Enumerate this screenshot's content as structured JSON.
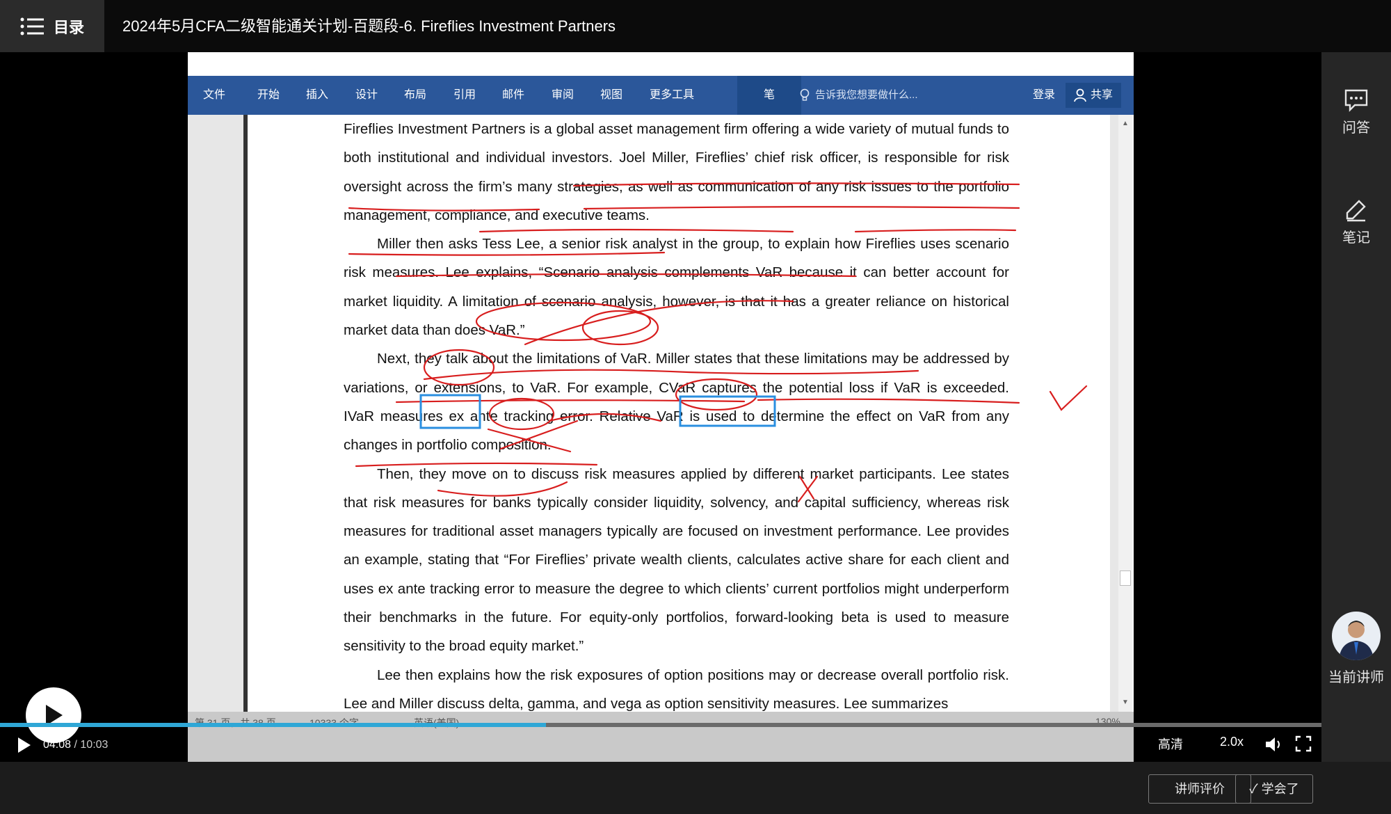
{
  "app": {
    "menu_label": "目录",
    "course_title": "2024年5月CFA二级智能通关计划-百题段-6. Fireflies Investment Partners"
  },
  "ribbon": {
    "tabs": [
      "文件",
      "开始",
      "插入",
      "设计",
      "布局",
      "引用",
      "邮件",
      "审阅",
      "视图",
      "更多工具",
      "笔"
    ],
    "tell_me": "告诉我您想要做什么...",
    "login": "登录",
    "share": "共享"
  },
  "document": {
    "paragraphs": [
      "Fireflies Investment Partners is a global asset management firm offering a wide variety of mutual funds to both institutional and individual investors. Joel Miller, Fireflies’ chief risk officer, is responsible for risk oversight across the firm’s many strategies, as well as communication of any risk issues to the portfolio management, compliance, and executive teams.",
      "Miller then asks Tess Lee, a senior risk analyst in the group, to explain how Fireflies uses scenario risk measures. Lee explains, “Scenario analysis complements VaR because it can better account for market liquidity. A limitation of scenario analysis, however, is that it has a greater reliance on historical market data than does VaR.”",
      "Next, they talk about the limitations of VaR. Miller states that these limitations may be addressed by variations, or extensions, to VaR. For example, CVaR captures the potential loss if VaR is exceeded. IVaR measures ex ante tracking error. Relative VaR is used to determine the effect on VaR from any changes in portfolio composition.",
      "Then, they move on to discuss risk measures applied by different market participants. Lee states that risk measures for banks typically consider liquidity, solvency, and capital sufficiency, whereas risk measures for traditional asset managers typically are focused on investment performance. Lee provides an example, stating that “For Fireflies’ private wealth clients, calculates active share for each client and uses ex ante tracking error to measure the degree to which clients’ current portfolios might underperform their benchmarks in the future. For equity-only portfolios, forward-looking beta is used to measure sensitivity to the broad equity market.”",
      "Lee then explains how the risk exposures of option positions may or decrease overall portfolio risk. Lee and Miller discuss delta, gamma, and vega as option sensitivity measures. Lee summarizes"
    ],
    "status": {
      "page": "第 31 页，共 38 页",
      "words": "10333 个字",
      "language": "英语(美国)",
      "zoom": "130%"
    }
  },
  "player": {
    "current_time": "04:08",
    "separator": "/",
    "total_time": "10:03",
    "progress": 0.413,
    "quality": "高清",
    "speed": "2.0x"
  },
  "sidebar": {
    "qa_label": "问答",
    "notes_label": "笔记",
    "teacher_label": "当前讲师"
  },
  "bottom": {
    "rate_teacher": "讲师评价",
    "learned": "学会了"
  },
  "colors": {
    "ribbon": "#2b579a",
    "progress_fill": "#2fa7d6",
    "annotation_red": "#d81e1e",
    "annotation_blue": "#2a8fe0"
  }
}
